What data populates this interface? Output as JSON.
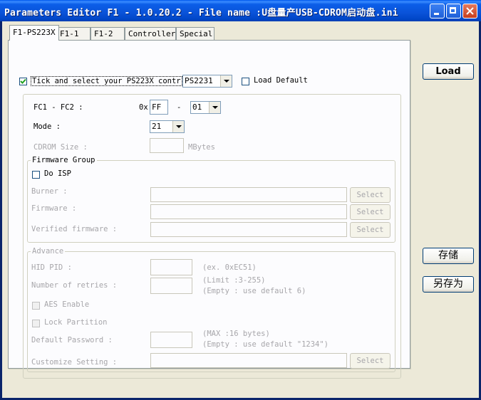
{
  "window": {
    "title": "Parameters Editor F1 - 1.0.20.2 - File name :U盘量产USB-CDROM启动盘.ini"
  },
  "tabs": [
    {
      "label": "F1-PS223X"
    },
    {
      "label": "F1-1"
    },
    {
      "label": "F1-2"
    },
    {
      "label": "Controller"
    },
    {
      "label": "Special"
    }
  ],
  "top": {
    "tick_label": "Tick and select your PS223X contr",
    "controller_value": "PS2231",
    "load_default_label": "Load Default"
  },
  "main": {
    "fc_label": "FC1 - FC2 :",
    "fc_prefix": "0x",
    "fc1_value": "FF",
    "fc_dash": "-",
    "fc2_value": "01",
    "mode_label": "Mode :",
    "mode_value": "21",
    "cdrom_label": "CDROM Size :",
    "cdrom_unit": "MBytes"
  },
  "firmware_group": {
    "title": "Firmware Group",
    "do_isp_label": "Do ISP",
    "burner_label": "Burner :",
    "firmware_label": "Firmware :",
    "verified_label": "Verified firmware :",
    "select_label": "Select"
  },
  "advance_group": {
    "title": "Advance",
    "hid_pid_label": "HID PID :",
    "hid_pid_hint": "(ex. 0xEC51)",
    "retries_label": "Number of retries :",
    "retries_hint1": "(Limit :3-255)",
    "retries_hint2": "(Empty : use default 6)",
    "aes_label": "AES Enable",
    "lock_label": "Lock Partition",
    "password_label": "Default Password :",
    "password_hint1": "(MAX :16 bytes)",
    "password_hint2": "(Empty : use default \"1234\")",
    "customize_label": "Customize Setting :",
    "select_label": "Select"
  },
  "right_buttons": {
    "load": "Load",
    "save": "存储",
    "save_as": "另存为"
  }
}
